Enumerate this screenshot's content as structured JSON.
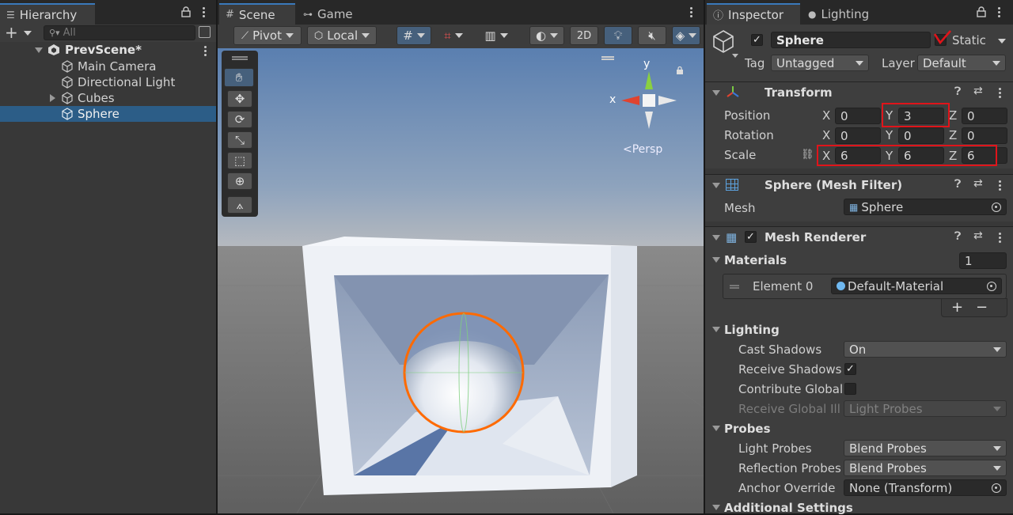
{
  "hierarchy": {
    "tab_label": "Hierarchy",
    "search_placeholder": "All",
    "scene_name": "PrevScene*",
    "items": [
      {
        "label": "Main Camera"
      },
      {
        "label": "Directional Light"
      },
      {
        "label": "Cubes"
      },
      {
        "label": "Sphere",
        "selected": true
      }
    ]
  },
  "scene_view": {
    "tabs": [
      "Scene",
      "Game"
    ],
    "toolbar": {
      "pivot": "Pivot",
      "local": "Local",
      "mode_2d": "2D"
    },
    "gizmo": {
      "y": "y",
      "x": "x",
      "persp": "<Persp"
    },
    "colors": {
      "selection_outline": "#ff6a00",
      "sky_top": "#5a7fb0",
      "ground": "#6d6d6d"
    }
  },
  "inspector": {
    "tabs": [
      "Inspector",
      "Lighting"
    ],
    "object_name": "Sphere",
    "static_label": "Static",
    "tag_label": "Tag",
    "tag_value": "Untagged",
    "layer_label": "Layer",
    "layer_value": "Default",
    "transform": {
      "title": "Transform",
      "position": {
        "label": "Position",
        "x": "0",
        "y": "3",
        "z": "0"
      },
      "rotation": {
        "label": "Rotation",
        "x": "0",
        "y": "0",
        "z": "0"
      },
      "scale": {
        "label": "Scale",
        "x": "6",
        "y": "6",
        "z": "6"
      },
      "axes": {
        "x": "X",
        "y": "Y",
        "z": "Z"
      }
    },
    "mesh_filter": {
      "title": "Sphere (Mesh Filter)",
      "mesh_label": "Mesh",
      "mesh_value": "Sphere"
    },
    "mesh_renderer": {
      "title": "Mesh Renderer",
      "materials_label": "Materials",
      "materials_count": "1",
      "element_label": "Element 0",
      "element_value": "Default-Material",
      "plus": "+",
      "minus": "−"
    },
    "lighting": {
      "title": "Lighting",
      "cast_shadows_label": "Cast Shadows",
      "cast_shadows_value": "On",
      "receive_shadows_label": "Receive Shadows",
      "contribute_gi_label": "Contribute Global",
      "receive_gi_label": "Receive Global Illu",
      "receive_gi_value": "Light Probes"
    },
    "probes": {
      "title": "Probes",
      "light_probes_label": "Light Probes",
      "light_probes_value": "Blend Probes",
      "reflection_probes_label": "Reflection Probes",
      "reflection_probes_value": "Blend Probes",
      "anchor_label": "Anchor Override",
      "anchor_value": "None (Transform)"
    },
    "additional": {
      "title": "Additional Settings"
    },
    "colors": {
      "highlight": "#e0141a",
      "selected_row": "#2c5d87"
    }
  }
}
